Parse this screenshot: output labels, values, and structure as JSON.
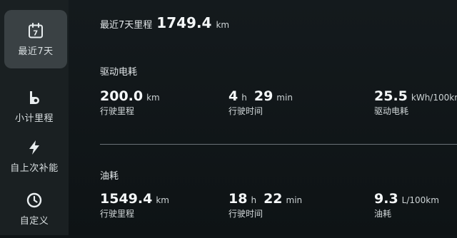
{
  "sidebar": {
    "items": [
      {
        "label": "最近7天",
        "icon": "calendar-icon",
        "icon_text": "7",
        "active": true
      },
      {
        "label": "小计里程",
        "icon": "odometer-icon",
        "active": false
      },
      {
        "label": "自上次补能",
        "icon": "lightning-icon",
        "active": false
      },
      {
        "label": "自定义",
        "icon": "clock-icon",
        "active": false
      }
    ]
  },
  "summary": {
    "label": "最近7天里程",
    "value": "1749.4",
    "unit": "km"
  },
  "electric": {
    "title": "驱动电耗",
    "distance": {
      "value": "200.0",
      "unit": "km",
      "label": "行驶里程"
    },
    "time": {
      "hours": "4",
      "hours_unit": "h",
      "minutes": "29",
      "minutes_unit": "min",
      "label": "行驶时间"
    },
    "consumption": {
      "value": "25.5",
      "unit": "kWh/100km",
      "label": "驱动电耗"
    }
  },
  "fuel": {
    "title": "油耗",
    "distance": {
      "value": "1549.4",
      "unit": "km",
      "label": "行驶里程"
    },
    "time": {
      "hours": "18",
      "hours_unit": "h",
      "minutes": "22",
      "minutes_unit": "min",
      "label": "行驶时间"
    },
    "consumption": {
      "value": "9.3",
      "unit": "L/100km",
      "label": "油耗"
    }
  },
  "colors": {
    "background": "#0f1416",
    "sidebar": "#1a2022",
    "active_item": "#3a4144",
    "divider": "#6b7377"
  }
}
